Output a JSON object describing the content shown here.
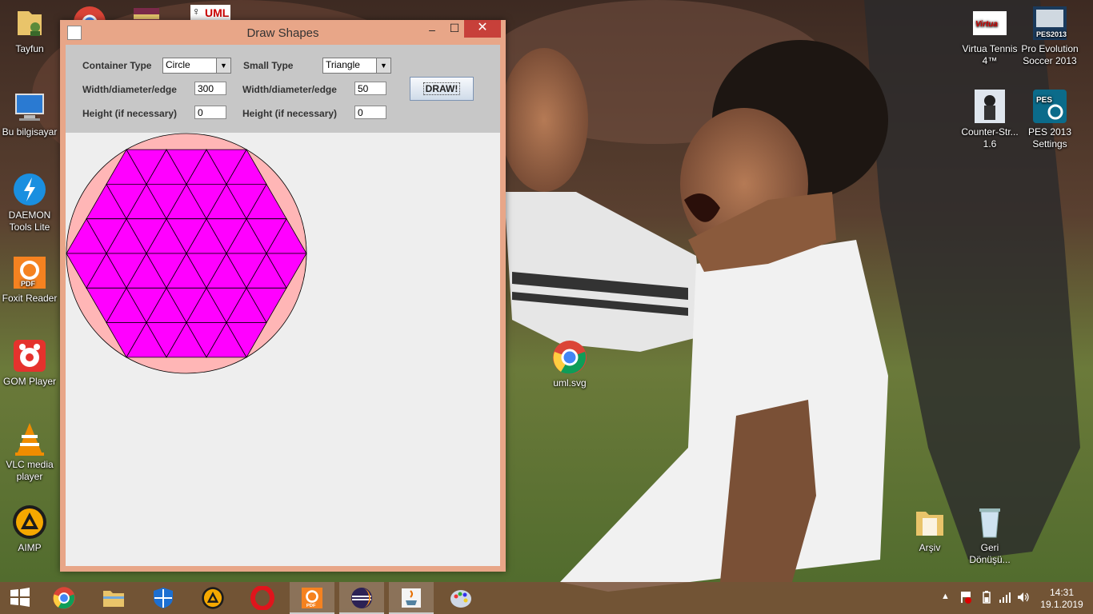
{
  "desktop": {
    "left_icons": [
      {
        "name": "tayfun-user-folder-icon",
        "label": "Tayfun"
      },
      {
        "name": "this-pc-icon",
        "label": "Bu bilgisayar"
      },
      {
        "name": "daemon-tools-icon",
        "label": "DAEMON Tools Lite"
      },
      {
        "name": "foxit-reader-icon",
        "label": "Foxit Reader"
      },
      {
        "name": "gom-player-icon",
        "label": "GOM Player"
      },
      {
        "name": "vlc-icon",
        "label": "VLC media player"
      },
      {
        "name": "aimp-icon",
        "label": "AIMP"
      }
    ],
    "top_partial_icons": [
      {
        "name": "chrome-partial-icon"
      },
      {
        "name": "winrar-partial-icon"
      },
      {
        "name": "uml-partial-icon",
        "text": "UML"
      }
    ],
    "center_icon": {
      "label": "uml.svg"
    },
    "right_icons": [
      {
        "name": "virtua-tennis-icon",
        "label": "Virtua Tennis 4™"
      },
      {
        "name": "pes2013-icon",
        "label": "Pro Evolution Soccer 2013"
      },
      {
        "name": "counter-strike-icon",
        "label": "Counter-Str... 1.6"
      },
      {
        "name": "pes2013-settings-icon",
        "label": "PES 2013 Settings"
      },
      {
        "name": "archive-folder-icon",
        "label": "Arşiv"
      },
      {
        "name": "recycle-bin-icon",
        "label": "Geri Dönüşü..."
      }
    ]
  },
  "window": {
    "title": "Draw Shapes",
    "min_label": "–",
    "max_label": "☐",
    "close_label": "✕",
    "controls": {
      "container_type_label": "Container Type",
      "container_type_value": "Circle",
      "small_type_label": "Small Type",
      "small_type_value": "Triangle",
      "width_label_1": "Width/diameter/edge",
      "width_value_1": "300",
      "width_label_2": "Width/diameter/edge",
      "width_value_2": "50",
      "height_label_1": "Height (if necessary)",
      "height_value_1": "0",
      "height_label_2": "Height (if necessary)",
      "height_value_2": "0",
      "draw_button": "DRAW!"
    },
    "drawing": {
      "container_diameter": 300,
      "small_edge": 50,
      "container_color": "#ffb6b6",
      "fill_color": "#ff00ff",
      "line_color": "#000000"
    }
  },
  "taskbar": {
    "items": [
      "start",
      "chrome",
      "file-explorer",
      "defender",
      "aimp",
      "opera",
      "foxit",
      "eclipse",
      "java",
      "paint"
    ],
    "clock_time": "14:31",
    "clock_date": "19.1.2019"
  }
}
